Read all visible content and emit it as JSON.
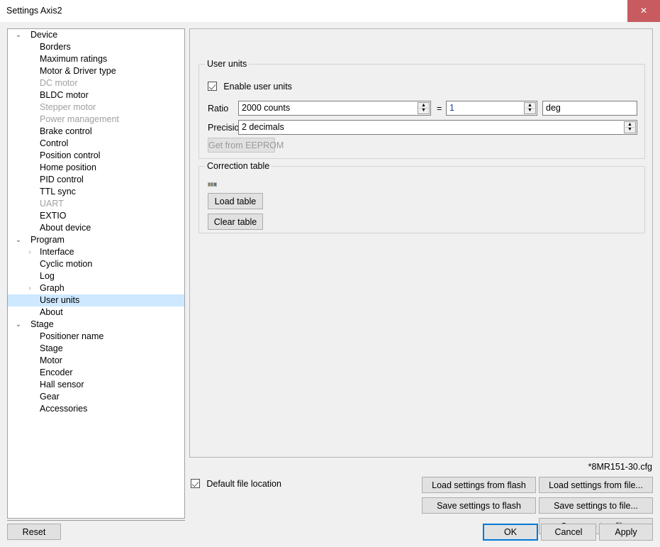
{
  "window": {
    "title": "Settings Axis2",
    "close_icon": "close-icon",
    "close_glyph": "✕",
    "close_color": "#c75b60"
  },
  "tree": {
    "expanded_glyph": "⌄",
    "collapsed_glyph": "›",
    "items": [
      {
        "label": "Device",
        "level": 0,
        "arrow": "expanded",
        "disabled": false,
        "selected": false
      },
      {
        "label": "Borders",
        "level": 1,
        "arrow": "none",
        "disabled": false,
        "selected": false
      },
      {
        "label": "Maximum ratings",
        "level": 1,
        "arrow": "none",
        "disabled": false,
        "selected": false
      },
      {
        "label": "Motor & Driver type",
        "level": 1,
        "arrow": "none",
        "disabled": false,
        "selected": false
      },
      {
        "label": "DC motor",
        "level": 1,
        "arrow": "none",
        "disabled": true,
        "selected": false
      },
      {
        "label": "BLDC motor",
        "level": 1,
        "arrow": "none",
        "disabled": false,
        "selected": false
      },
      {
        "label": "Stepper motor",
        "level": 1,
        "arrow": "none",
        "disabled": true,
        "selected": false
      },
      {
        "label": "Power management",
        "level": 1,
        "arrow": "none",
        "disabled": true,
        "selected": false
      },
      {
        "label": "Brake control",
        "level": 1,
        "arrow": "none",
        "disabled": false,
        "selected": false
      },
      {
        "label": "Control",
        "level": 1,
        "arrow": "none",
        "disabled": false,
        "selected": false
      },
      {
        "label": "Position control",
        "level": 1,
        "arrow": "none",
        "disabled": false,
        "selected": false
      },
      {
        "label": "Home position",
        "level": 1,
        "arrow": "none",
        "disabled": false,
        "selected": false
      },
      {
        "label": "PID control",
        "level": 1,
        "arrow": "none",
        "disabled": false,
        "selected": false
      },
      {
        "label": "TTL sync",
        "level": 1,
        "arrow": "none",
        "disabled": false,
        "selected": false
      },
      {
        "label": "UART",
        "level": 1,
        "arrow": "none",
        "disabled": true,
        "selected": false
      },
      {
        "label": "EXTIO",
        "level": 1,
        "arrow": "none",
        "disabled": false,
        "selected": false
      },
      {
        "label": "About device",
        "level": 1,
        "arrow": "none",
        "disabled": false,
        "selected": false
      },
      {
        "label": "Program",
        "level": 0,
        "arrow": "expanded",
        "disabled": false,
        "selected": false
      },
      {
        "label": "Interface",
        "level": 1,
        "arrow": "collapsed",
        "disabled": false,
        "selected": false
      },
      {
        "label": "Cyclic motion",
        "level": 1,
        "arrow": "none",
        "disabled": false,
        "selected": false
      },
      {
        "label": "Log",
        "level": 1,
        "arrow": "none",
        "disabled": false,
        "selected": false
      },
      {
        "label": "Graph",
        "level": 1,
        "arrow": "collapsed",
        "disabled": false,
        "selected": false
      },
      {
        "label": "User units",
        "level": 1,
        "arrow": "none",
        "disabled": false,
        "selected": true
      },
      {
        "label": "About",
        "level": 1,
        "arrow": "none",
        "disabled": false,
        "selected": false
      },
      {
        "label": "Stage",
        "level": 0,
        "arrow": "expanded",
        "disabled": false,
        "selected": false
      },
      {
        "label": "Positioner name",
        "level": 1,
        "arrow": "none",
        "disabled": false,
        "selected": false
      },
      {
        "label": "Stage",
        "level": 1,
        "arrow": "none",
        "disabled": false,
        "selected": false
      },
      {
        "label": "Motor",
        "level": 1,
        "arrow": "none",
        "disabled": false,
        "selected": false
      },
      {
        "label": "Encoder",
        "level": 1,
        "arrow": "none",
        "disabled": false,
        "selected": false
      },
      {
        "label": "Hall sensor",
        "level": 1,
        "arrow": "none",
        "disabled": false,
        "selected": false
      },
      {
        "label": "Gear",
        "level": 1,
        "arrow": "none",
        "disabled": false,
        "selected": false
      },
      {
        "label": "Accessories",
        "level": 1,
        "arrow": "none",
        "disabled": false,
        "selected": false
      }
    ],
    "selected_bg": "#cde8ff"
  },
  "user_units": {
    "group_title": "User units",
    "enable_checkbox_label": "Enable user units",
    "enable_checked": true,
    "ratio_label": "Ratio",
    "ratio_counts_value": "2000 counts",
    "equals_sign": "=",
    "ratio_units_value": "1",
    "unit_name_value": "deg",
    "precision_label": "Precision",
    "precision_value": "2 decimals",
    "eeprom_button_label": "Get from EEPROM",
    "eeprom_button_disabled": true,
    "spin_up_glyph": "▲",
    "spin_down_glyph": "▼"
  },
  "correction_table": {
    "group_title": "Correction table",
    "load_button_label": "Load table",
    "clear_button_label": "Clear table",
    "preview_icon": "table-preview-icon"
  },
  "file_bar": {
    "filename": "*8MR151-30.cfg",
    "default_location_label": "Default file location",
    "default_location_checked": true,
    "load_from_flash_label": "Load settings from flash",
    "load_from_file_label": "Load settings from file...",
    "save_to_flash_label": "Save settings to flash",
    "save_to_file_label": "Save settings to file...",
    "compare_two_files_label": "Compare two files"
  },
  "footer": {
    "reset_label": "Reset",
    "ok_label": "OK",
    "cancel_label": "Cancel",
    "apply_label": "Apply",
    "focus_color": "#0078d7"
  }
}
